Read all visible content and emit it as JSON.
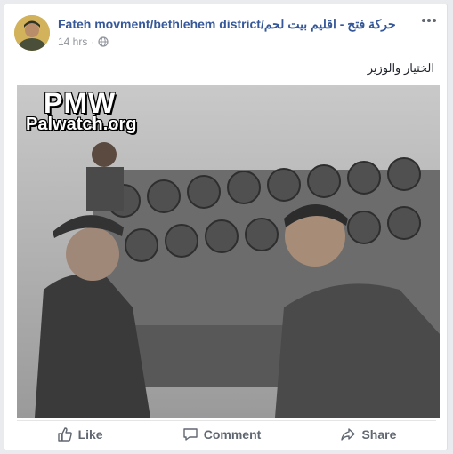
{
  "post": {
    "page_name": "Fateh movment/bethlehem district/حركة فتح - اقليم بيت لحم",
    "timestamp": "14 hrs",
    "separator": "·",
    "privacy_icon": "globe-icon",
    "caption": "الختيار والوزير"
  },
  "photo": {
    "watermark_line1": "PMW",
    "watermark_line2": "Palwatch.org"
  },
  "actions": {
    "like_label": "Like",
    "comment_label": "Comment",
    "share_label": "Share"
  },
  "colors": {
    "link_blue": "#365899",
    "meta_gray": "#90949c",
    "action_gray": "#606770",
    "background": "#e9ebee"
  }
}
